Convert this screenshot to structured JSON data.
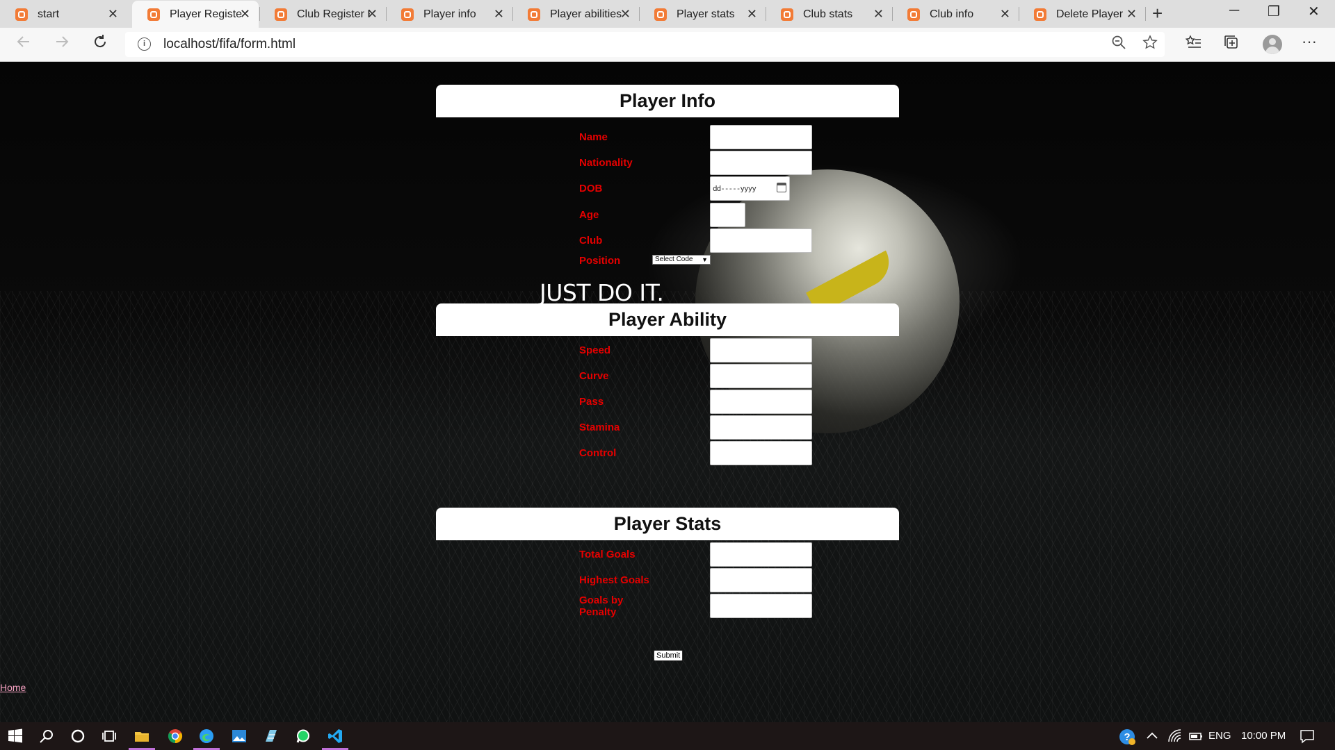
{
  "browser": {
    "tabs": [
      {
        "label": "start",
        "active": false
      },
      {
        "label": "Player Register",
        "active": true
      },
      {
        "label": "Club Register F",
        "active": false
      },
      {
        "label": "Player info",
        "active": false
      },
      {
        "label": "Player abilities",
        "active": false
      },
      {
        "label": "Player stats",
        "active": false
      },
      {
        "label": "Club stats",
        "active": false
      },
      {
        "label": "Club info",
        "active": false
      },
      {
        "label": "Delete Player",
        "active": false
      }
    ],
    "tab_close_glyph": "✕",
    "new_tab_glyph": "+",
    "url": "localhost/fifa/form.html",
    "window_controls": {
      "minimize": "─",
      "maximize": "❐",
      "close": "✕"
    },
    "icons": {
      "back": "back-arrow-icon",
      "forward": "forward-arrow-icon",
      "refresh": "refresh-icon",
      "info": "site-info-icon",
      "zoom": "zoom-icon",
      "favorite": "star-icon",
      "favorites": "favorites-list-icon",
      "collections": "collections-icon",
      "profile": "profile-avatar-icon",
      "more": "more-options-icon"
    }
  },
  "page": {
    "slogan": "JUST DO IT.",
    "sections": {
      "info": {
        "title": "Player Info",
        "fields": {
          "name": {
            "label": "Name",
            "value": ""
          },
          "nationality": {
            "label": "Nationality",
            "value": ""
          },
          "dob": {
            "label": "DOB",
            "placeholder": "dd-----yyyy"
          },
          "age": {
            "label": "Age",
            "value": ""
          },
          "club": {
            "label": "Club",
            "value": ""
          },
          "position": {
            "label": "Position",
            "selected": "Select Code"
          }
        }
      },
      "ability": {
        "title": "Player Ability",
        "fields": {
          "speed": {
            "label": "Speed",
            "value": ""
          },
          "curve": {
            "label": "Curve",
            "value": ""
          },
          "pass": {
            "label": "Pass",
            "value": ""
          },
          "stamina": {
            "label": "Stamina",
            "value": ""
          },
          "control": {
            "label": "Control",
            "value": ""
          }
        }
      },
      "stats": {
        "title": "Player Stats",
        "fields": {
          "total_goals": {
            "label": "Total Goals",
            "value": ""
          },
          "highest_goals": {
            "label": "Highest Goals",
            "value": ""
          },
          "goals_by_penalty": {
            "label": "Goals by Penalty",
            "value": ""
          }
        }
      }
    },
    "submit_label": "Submit",
    "home_link": "Home",
    "colors": {
      "label": "#e60000",
      "section_bar": "#ffffff",
      "link": "#f4a0c0",
      "tab_favicon": "#f27b36"
    }
  },
  "taskbar": {
    "apps": [
      "start-button",
      "search-icon",
      "cortana-icon",
      "task-view-icon",
      "file-explorer-icon",
      "chrome-icon",
      "edge-icon",
      "photos-icon",
      "notepad-icon",
      "whatsapp-icon",
      "vscode-icon"
    ],
    "tray": {
      "language": "ENG",
      "time": "10:00 PM"
    }
  }
}
